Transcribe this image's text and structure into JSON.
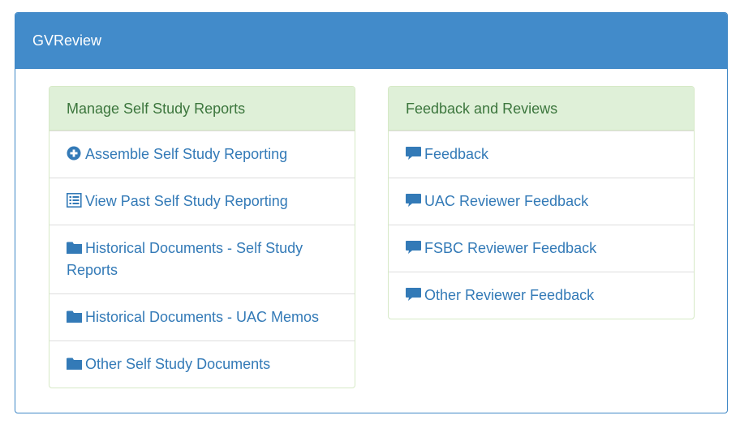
{
  "panel": {
    "title": "GVReview"
  },
  "left_column": {
    "heading": "Manage Self Study Reports",
    "items": [
      {
        "label": "Assemble Self Study Reporting",
        "icon": "plus-circle-icon"
      },
      {
        "label": "View Past Self Study Reporting",
        "icon": "list-icon"
      },
      {
        "label": "Historical Documents - Self Study Reports",
        "icon": "folder-icon"
      },
      {
        "label": "Historical Documents - UAC Memos",
        "icon": "folder-icon"
      },
      {
        "label": "Other Self Study Documents",
        "icon": "folder-icon"
      }
    ]
  },
  "right_column": {
    "heading": "Feedback and Reviews",
    "items": [
      {
        "label": "Feedback",
        "icon": "comment-icon"
      },
      {
        "label": "UAC Reviewer Feedback",
        "icon": "comment-icon"
      },
      {
        "label": "FSBC Reviewer Feedback",
        "icon": "comment-icon"
      },
      {
        "label": "Other Reviewer Feedback",
        "icon": "comment-icon"
      }
    ]
  },
  "colors": {
    "primary": "#428bca",
    "link": "#337ab7",
    "success_bg": "#dff0d8",
    "success_text": "#3c763d"
  }
}
